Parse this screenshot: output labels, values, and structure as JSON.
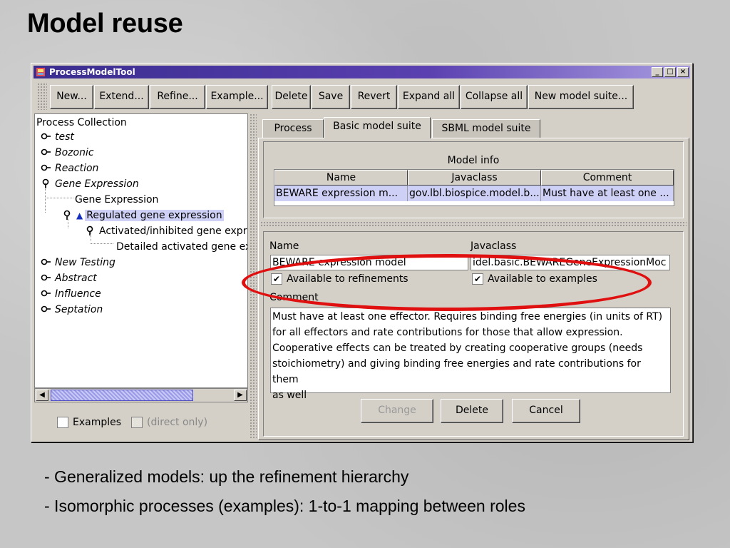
{
  "slide": {
    "title": "Model reuse",
    "bullets": [
      "- Generalized models: up the refinement hierarchy",
      "- Isomorphic processes (examples): 1-to-1 mapping between roles"
    ]
  },
  "window": {
    "title": "ProcessModelTool",
    "icon": "app-icon",
    "controls": [
      "minimize-icon",
      "maximize-icon",
      "close-icon"
    ]
  },
  "toolbar": {
    "buttons": [
      "New...",
      "Extend...",
      "Refine...",
      "Example...",
      "Delete",
      "Save",
      "Revert",
      "Expand all",
      "Collapse all",
      "New model suite..."
    ]
  },
  "tree": {
    "header": "Process Collection",
    "items": [
      "test",
      "Bozonic",
      "Reaction",
      "Gene Expression",
      "Gene Expression",
      "Regulated gene expression",
      "Activated/inhibited gene expre",
      "Detailed activated gene ex",
      "New Testing",
      "Abstract",
      "Influence",
      "Septation"
    ]
  },
  "filters": {
    "examples_label": "Examples",
    "direct_only_label": "(direct only)"
  },
  "tabs": [
    "Process",
    "Basic model suite",
    "SBML model suite"
  ],
  "model_info": {
    "title": "Model info",
    "columns": [
      "Name",
      "Javaclass",
      "Comment"
    ],
    "row": [
      "BEWARE expression m...",
      "gov.lbl.biospice.model.b...",
      "Must have at least one ..."
    ]
  },
  "detail": {
    "name_label": "Name",
    "name_value": "BEWARE expression model",
    "javaclass_label": "Javaclass",
    "javaclass_value": "idel.basic.BEWAREGeneExpressionMoc",
    "available_refinements": "Available to refinements",
    "available_examples": "Available to examples",
    "comment_label": "Comment",
    "comment_lines": [
      "Must have at least one effector.  Requires binding free energies (in units of RT)",
      "for all effectors and rate contributions for those that allow expression.",
      "Cooperative effects can be treated by creating cooperative groups (needs",
      "stoichiometry) and giving binding free energies and rate contributions for them",
      "as well"
    ],
    "buttons": {
      "change": "Change",
      "delete": "Delete",
      "cancel": "Cancel"
    }
  },
  "colors": {
    "annotation_ellipse": "#e01010",
    "titlebar": "#3a2d8f",
    "selection": "#cfd0f5"
  }
}
